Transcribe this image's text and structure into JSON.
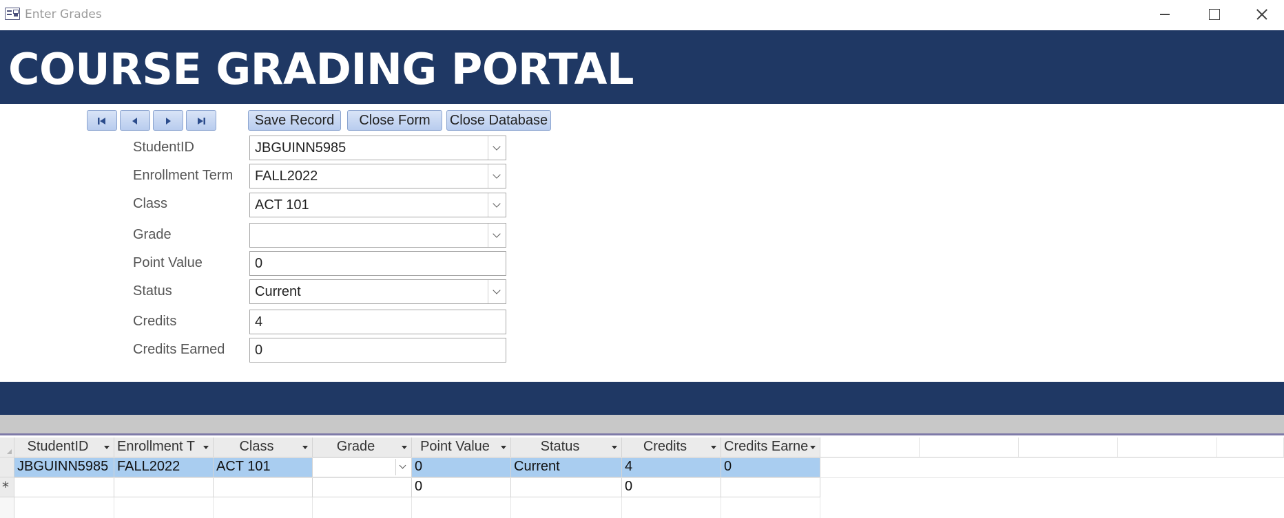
{
  "window": {
    "title": "Enter Grades",
    "controls": [
      "minimize",
      "maximize",
      "close"
    ]
  },
  "header": {
    "title": "COURSE GRADING PORTAL",
    "background_color": "#1f3864"
  },
  "navigation": {
    "buttons": [
      {
        "name": "first-record",
        "icon": "first-record-icon"
      },
      {
        "name": "previous-record",
        "icon": "previous-record-icon"
      },
      {
        "name": "next-record",
        "icon": "next-record-icon"
      },
      {
        "name": "last-record",
        "icon": "last-record-icon"
      }
    ]
  },
  "actions": {
    "save_label": "Save Record",
    "close_form_label": "Close Form",
    "close_database_label": "Close Database"
  },
  "form": {
    "student_id": {
      "label": "StudentID",
      "value": "JBGUINN5985",
      "type": "combo"
    },
    "enrollment_term": {
      "label": "Enrollment Term",
      "value": "FALL2022",
      "type": "combo"
    },
    "class": {
      "label": "Class",
      "value": "ACT 101",
      "type": "combo"
    },
    "grade": {
      "label": "Grade",
      "value": "",
      "type": "combo"
    },
    "point_value": {
      "label": "Point Value",
      "value": "0",
      "type": "text"
    },
    "status": {
      "label": "Status",
      "value": "Current",
      "type": "combo"
    },
    "credits": {
      "label": "Credits",
      "value": "4",
      "type": "text"
    },
    "credits_earned": {
      "label": "Credits Earned",
      "value": "0",
      "type": "text"
    }
  },
  "datasheet": {
    "columns": [
      "StudentID",
      "Enrollment T",
      "Class",
      "Grade",
      "Point Value",
      "Status",
      "Credits",
      "Credits Earne"
    ],
    "rows": [
      {
        "student_id": "JBGUINN5985",
        "enrollment_term": "FALL2022",
        "class": "ACT 101",
        "grade": "",
        "point_value": "0",
        "status": "Current",
        "credits": "4",
        "credits_earned": "0"
      }
    ],
    "new_row": {
      "marker": "*",
      "point_value": "0",
      "credits": "0"
    },
    "selection_color": "#a9cdf0"
  }
}
